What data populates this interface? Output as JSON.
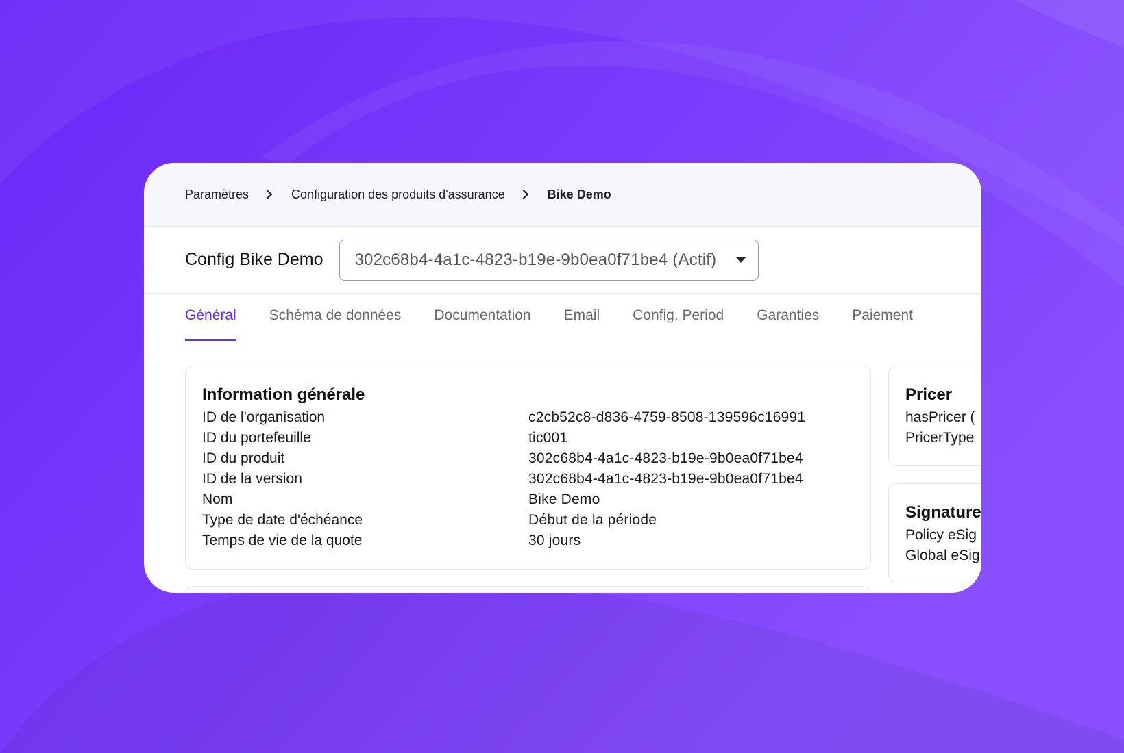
{
  "colors": {
    "background": "#7133fb",
    "accent": "#6a2ef0",
    "card": "#ffffff"
  },
  "breadcrumb": {
    "items": [
      "Paramètres",
      "Configuration des produits d'assurance"
    ],
    "current": "Bike Demo",
    "separator_icon": "chevron-right-icon"
  },
  "config": {
    "title": "Config Bike Demo",
    "version_select": {
      "value": "302c68b4-4a1c-4823-b19e-9b0ea0f71be4 (Actif)",
      "icon": "caret-down-icon"
    }
  },
  "tabs": [
    {
      "label": "Général",
      "active": true
    },
    {
      "label": "Schéma de données",
      "active": false
    },
    {
      "label": "Documentation",
      "active": false
    },
    {
      "label": "Email",
      "active": false
    },
    {
      "label": "Config. Period",
      "active": false
    },
    {
      "label": "Garanties",
      "active": false
    },
    {
      "label": "Paiement",
      "active": false
    }
  ],
  "general_info": {
    "title": "Information générale",
    "rows": [
      {
        "key": "ID de l'organisation",
        "value": "c2cb52c8-d836-4759-8508-139596c16991"
      },
      {
        "key": "ID du portefeuille",
        "value": "tic001"
      },
      {
        "key": "ID du produit",
        "value": "302c68b4-4a1c-4823-b19e-9b0ea0f71be4"
      },
      {
        "key": "ID de la version",
        "value": "302c68b4-4a1c-4823-b19e-9b0ea0f71be4"
      },
      {
        "key": "Nom",
        "value": "Bike Demo"
      },
      {
        "key": "Type de date d'échéance",
        "value": "Début de la période"
      },
      {
        "key": "Temps de vie de la quote",
        "value": "30 jours"
      }
    ]
  },
  "pricer": {
    "title": "Pricer",
    "rows": [
      "hasPricer (",
      "PricerType"
    ]
  },
  "signature": {
    "title": "Signature",
    "rows": [
      "Policy eSig",
      "Global eSig"
    ]
  }
}
